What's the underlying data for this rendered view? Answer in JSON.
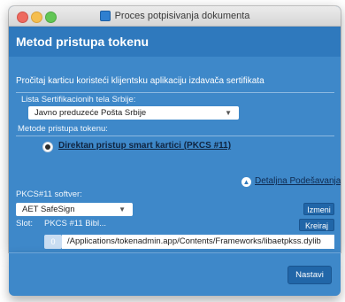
{
  "window": {
    "title": "Proces potpisivanja dokumenta"
  },
  "header": {
    "title": "Metod pristupa tokenu"
  },
  "main": {
    "description": "Pročitaj karticu koristeći klijentsku aplikaciju izdavača sertifikata",
    "ca_list_label": "Lista Sertifikacionih tela Srbije:",
    "ca_selected": "Javno preduzeće Pošta Srbije",
    "access_methods_label": "Metode pristupa tokenu:",
    "radio_option": "Direktan pristup smart kartici (PKCS #11)",
    "details_link": "Detaljna Podešavanja",
    "software_label": "PKCS#11 softver:",
    "software_selected": "AET SafeSign",
    "change_button": "Izmeni",
    "slot_label": "Slot:",
    "slot_name": "PKCS #11 Bibl...",
    "create_button": "Kreiraj",
    "slot_number": "0",
    "library_path": "/Applications/tokenadmin.app/Contents/Frameworks/libaetpkss.dylib"
  },
  "footer": {
    "next_button": "Nastavi"
  },
  "colors": {
    "panel": "#3e88c9",
    "header": "#2f79bd",
    "button": "#2166a8"
  },
  "icons": {
    "app": "document-icon",
    "dropdown": "chevron-down-icon",
    "details": "chevron-up-circle-icon"
  }
}
